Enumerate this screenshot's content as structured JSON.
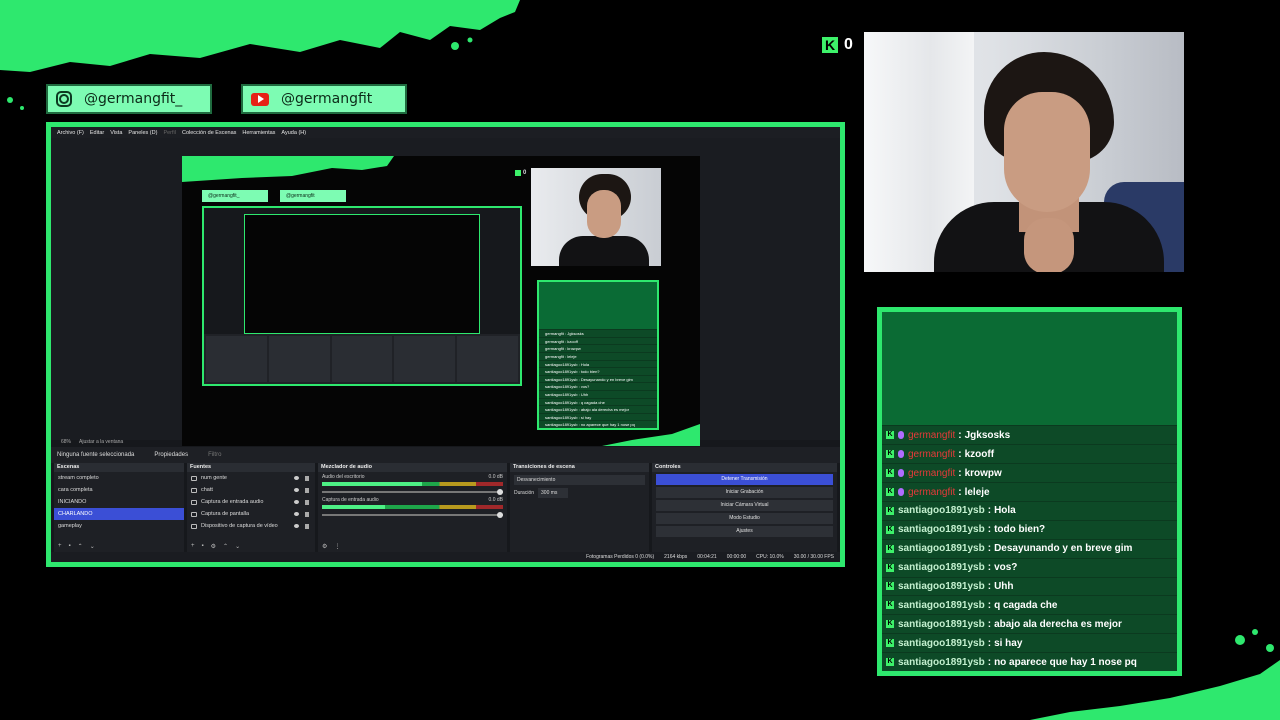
{
  "socials": [
    {
      "platform": "instagram",
      "icon": "instagram-icon",
      "handle": "@germangfit_"
    },
    {
      "platform": "youtube",
      "icon": "youtube-icon",
      "handle": "@germangfit"
    }
  ],
  "viewers": {
    "icon": "kick-logo-icon",
    "count": "0"
  },
  "colors": {
    "accent": "#2ee86e",
    "chat_bg": "#0d4a27",
    "highlight": "#3b4fd6"
  },
  "chat": {
    "messages": [
      {
        "user": "germangfit",
        "text": "Jgksosks",
        "highlight": true
      },
      {
        "user": "germangfit",
        "text": "kzooff",
        "highlight": true
      },
      {
        "user": "germangfit",
        "text": "krowpw",
        "highlight": true
      },
      {
        "user": "germangfit",
        "text": "leleje",
        "highlight": true
      },
      {
        "user": "santiagoo1891ysb",
        "text": "Hola",
        "highlight": false
      },
      {
        "user": "santiagoo1891ysb",
        "text": "todo bien?",
        "highlight": false
      },
      {
        "user": "santiagoo1891ysb",
        "text": "Desayunando y en breve gim",
        "highlight": false
      },
      {
        "user": "santiagoo1891ysb",
        "text": "vos?",
        "highlight": false
      },
      {
        "user": "santiagoo1891ysb",
        "text": "Uhh",
        "highlight": false
      },
      {
        "user": "santiagoo1891ysb",
        "text": "q cagada che",
        "highlight": false
      },
      {
        "user": "santiagoo1891ysb",
        "text": "abajo ala derecha es mejor",
        "highlight": false
      },
      {
        "user": "santiagoo1891ysb",
        "text": "si hay",
        "highlight": false
      },
      {
        "user": "santiagoo1891ysb",
        "text": "no aparece que hay 1 nose pq",
        "highlight": false
      }
    ]
  },
  "obs": {
    "menu": [
      "Archivo (F)",
      "Editar",
      "Vista",
      "Paneles (D)",
      "Perfil",
      "Colección de Escenas",
      "Herramientas",
      "Ayuda (H)"
    ],
    "zoom": "68%",
    "fit_label": "Ajustar a la ventana",
    "source_status": "Ninguna fuente seleccionada",
    "properties_label": "Propiedades",
    "filters_label": "Filtro",
    "scenes": {
      "title": "Escenas",
      "items": [
        "stream completo",
        "cara completa",
        "INICIANDO",
        "CHARLANDO",
        "gameplay"
      ],
      "selected": 3
    },
    "sources": {
      "title": "Fuentes",
      "items": [
        "num gente",
        "chatt",
        "Captura de entrada audio",
        "Captura de pantalla",
        "Dispositivo de captura de vídeo"
      ]
    },
    "mixer": {
      "title": "Mezclador de audio",
      "channels": [
        {
          "name": "Audio del escritorio",
          "db": "0.0 dB",
          "level": 0.55
        },
        {
          "name": "Captura de entrada audio",
          "db": "0.0 dB",
          "level": 0.35
        }
      ]
    },
    "transitions": {
      "title": "Transiciones de escena",
      "selected": "Desvanecimiento",
      "duration_label": "Duración",
      "duration_value": "300 ms"
    },
    "controls": {
      "title": "Controles",
      "buttons": [
        "Detener Transmisión",
        "Iniciar Grabación",
        "Iniciar Cámara Virtual",
        "Modo Estudio",
        "Ajustes"
      ]
    },
    "status": {
      "dropped": "Fotogramas Perdidos 0 (0.0%)",
      "bitrate": "2164 kbps",
      "live_time": "00:04:21",
      "rec_time": "00:00:00",
      "cpu": "CPU: 10.0%",
      "fps": "30.00 / 30.00 FPS"
    }
  }
}
